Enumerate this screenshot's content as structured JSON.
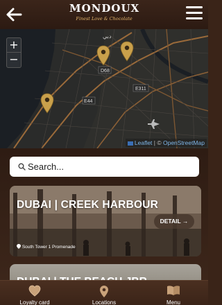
{
  "header": {
    "brand": "MONDOUX",
    "tagline": "Finest Love & Chocolate"
  },
  "map": {
    "labels": [
      "D68",
      "E311",
      "E44",
      "دبي"
    ],
    "zoom_in": "+",
    "zoom_out": "−",
    "attribution_leaflet": "Leaflet",
    "attribution_separator": " | © ",
    "attribution_osm": "OpenStreetMap"
  },
  "search": {
    "placeholder": "Search..."
  },
  "stores": [
    {
      "title": "DUBAI | CREEK HARBOUR",
      "detail_label": "DETAIL →",
      "address": "South Tower 1 Promenade"
    },
    {
      "title": "DUBAI | THE BEACH JBR"
    }
  ],
  "bottom_nav": {
    "loyalty": "Loyalty card",
    "locations": "Locations",
    "menu": "Menu"
  },
  "colors": {
    "brand_brown": "#3b251a",
    "pin_gold": "#c9a04b",
    "map_dark": "#1d2126",
    "tagline_gold": "#e3b46b"
  }
}
